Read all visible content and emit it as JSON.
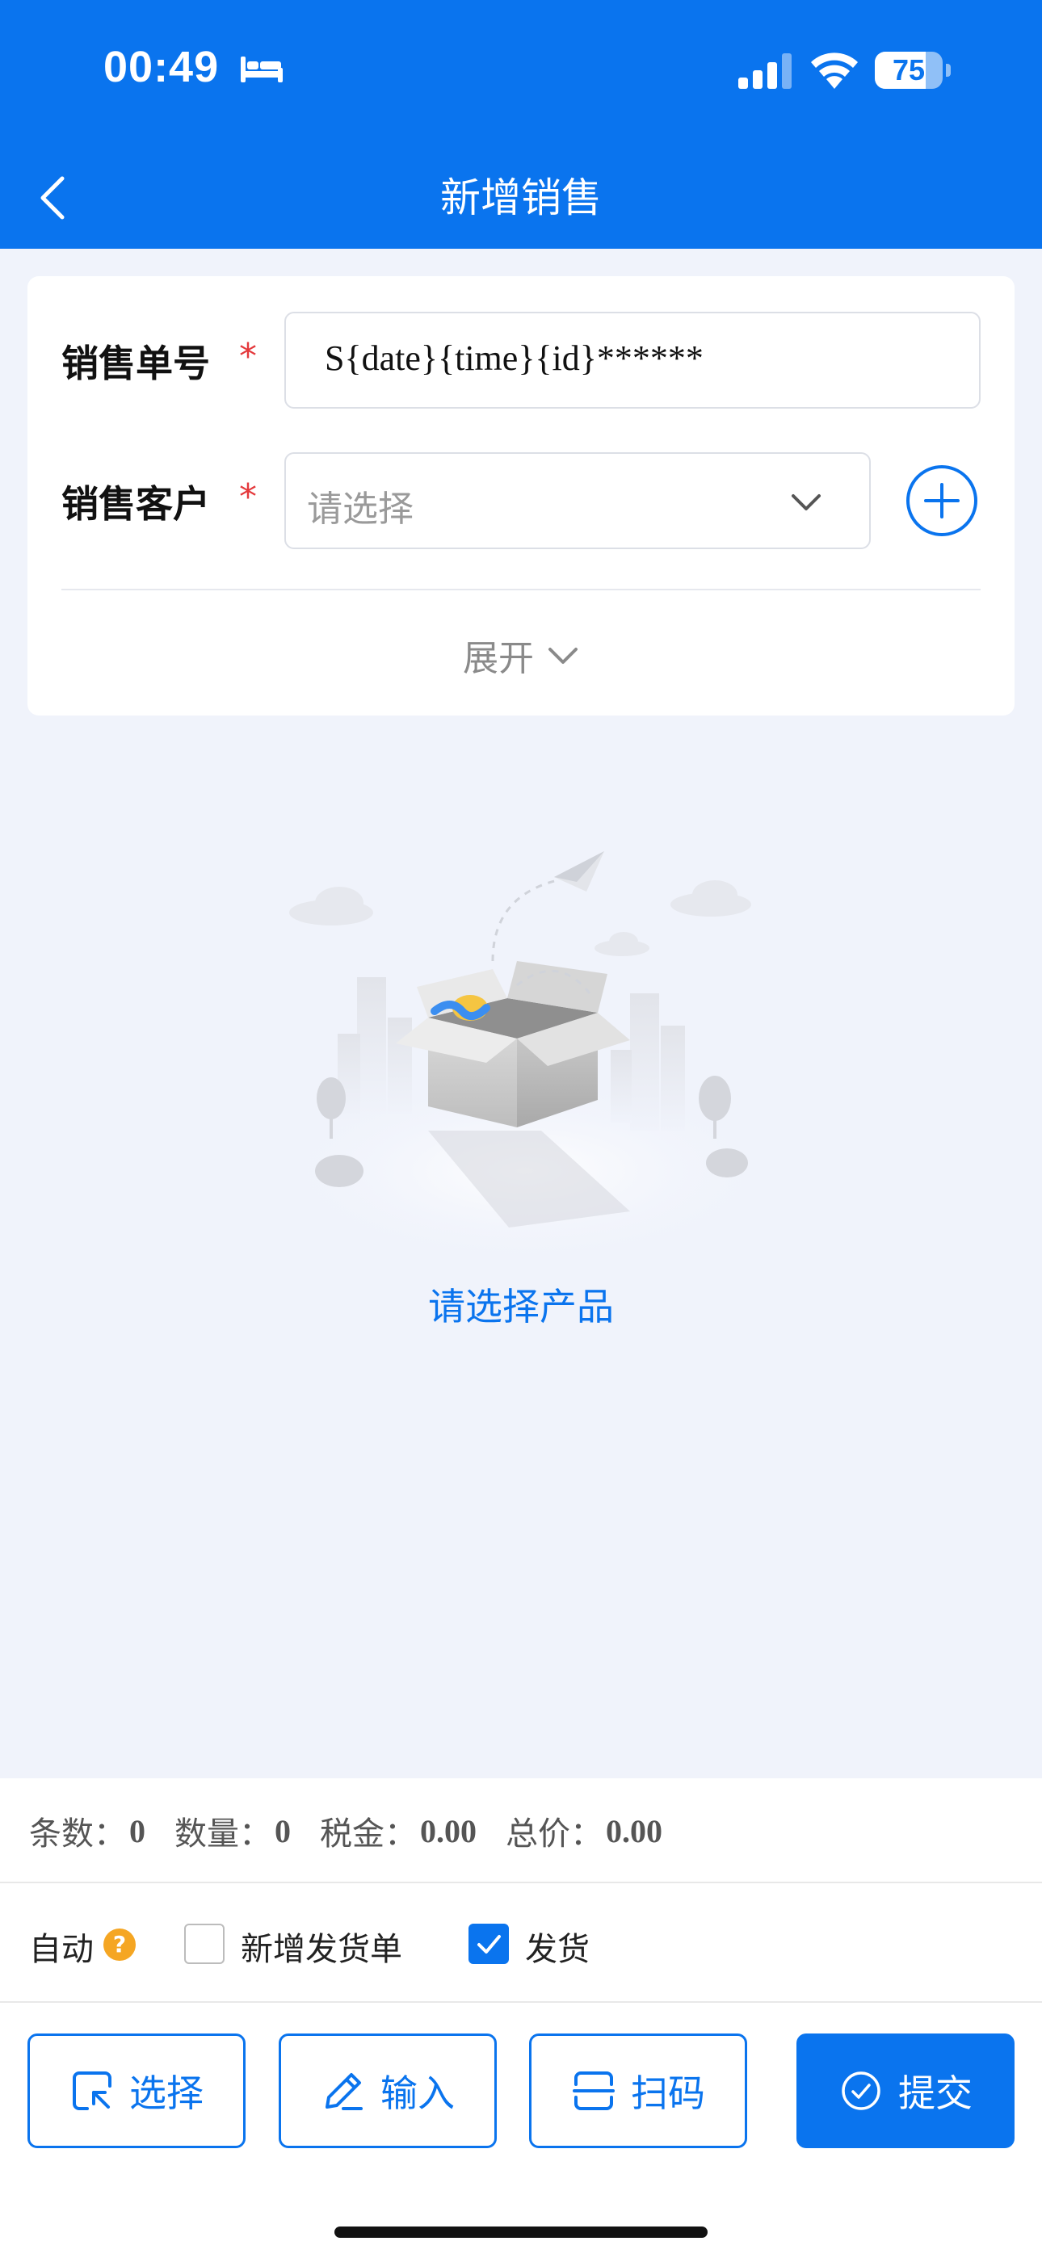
{
  "status_bar": {
    "time": "00:49",
    "battery": "75",
    "battery_level": 0.75,
    "icons": [
      "bed-icon",
      "cellular-signal-icon",
      "wifi-icon",
      "battery-icon"
    ]
  },
  "nav": {
    "title": "新增销售",
    "back_icon": "chevron-left-icon"
  },
  "form": {
    "order_no": {
      "label": "销售单号",
      "required_mark": "*",
      "value": "S{date}{time}{id}******"
    },
    "customer": {
      "label": "销售客户",
      "required_mark": "*",
      "placeholder": "请选择",
      "add_icon": "plus-circle-icon"
    },
    "expand_label": "展开"
  },
  "empty_state": {
    "illustration": "empty-box-illustration",
    "text": "请选择产品"
  },
  "summary": {
    "count_label": "条数：",
    "count_value": "0",
    "qty_label": "数量：",
    "qty_value": "0",
    "tax_label": "税金：",
    "tax_value": "0.00",
    "total_label": "总价：",
    "total_value": "0.00"
  },
  "options": {
    "auto_label": "自动",
    "help_mark": "?",
    "create_delivery_note": {
      "label": "新增发货单",
      "checked": false
    },
    "ship": {
      "label": "发货",
      "checked": true
    }
  },
  "actions": {
    "select": "选择",
    "input": "输入",
    "scan": "扫码",
    "submit": "提交"
  },
  "colors": {
    "primary": "#0a74ee",
    "background": "#f0f3fb",
    "required": "#e4393c",
    "help_badge": "#f5a623"
  }
}
